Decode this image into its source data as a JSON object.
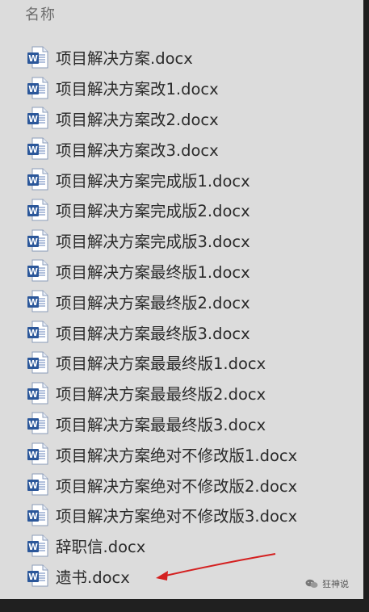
{
  "header": {
    "title": "名称"
  },
  "files": [
    {
      "name": "项目解决方案.docx",
      "icon": "word-doc-icon"
    },
    {
      "name": "项目解决方案改1.docx",
      "icon": "word-doc-icon"
    },
    {
      "name": "项目解决方案改2.docx",
      "icon": "word-doc-icon"
    },
    {
      "name": "项目解决方案改3.docx",
      "icon": "word-doc-icon"
    },
    {
      "name": "项目解决方案完成版1.docx",
      "icon": "word-doc-icon"
    },
    {
      "name": "项目解决方案完成版2.docx",
      "icon": "word-doc-icon"
    },
    {
      "name": "项目解决方案完成版3.docx",
      "icon": "word-doc-icon"
    },
    {
      "name": "项目解决方案最终版1.docx",
      "icon": "word-doc-icon"
    },
    {
      "name": "项目解决方案最终版2.docx",
      "icon": "word-doc-icon"
    },
    {
      "name": "项目解决方案最终版3.docx",
      "icon": "word-doc-icon"
    },
    {
      "name": "项目解决方案最最终版1.docx",
      "icon": "word-doc-icon"
    },
    {
      "name": "项目解决方案最最终版2.docx",
      "icon": "word-doc-icon"
    },
    {
      "name": "项目解决方案最最终版3.docx",
      "icon": "word-doc-icon"
    },
    {
      "name": "项目解决方案绝对不修改版1.docx",
      "icon": "word-doc-icon"
    },
    {
      "name": "项目解决方案绝对不修改版2.docx",
      "icon": "word-doc-icon"
    },
    {
      "name": "项目解决方案绝对不修改版3.docx",
      "icon": "word-doc-icon"
    },
    {
      "name": "辞职信.docx",
      "icon": "word-doc-icon"
    },
    {
      "name": "遗书.docx",
      "icon": "word-doc-icon"
    }
  ],
  "annotation": {
    "arrow_color": "#d42020",
    "points_to": "遗书.docx"
  },
  "watermark": {
    "text": "狂神说",
    "icon": "wechat-icon"
  },
  "colors": {
    "panel_bg": "#dcdcdc",
    "frame_bg": "#2b2b2b",
    "word_blue": "#2b579a",
    "text": "#2a2a2a",
    "header_text": "#6e6e6e"
  }
}
